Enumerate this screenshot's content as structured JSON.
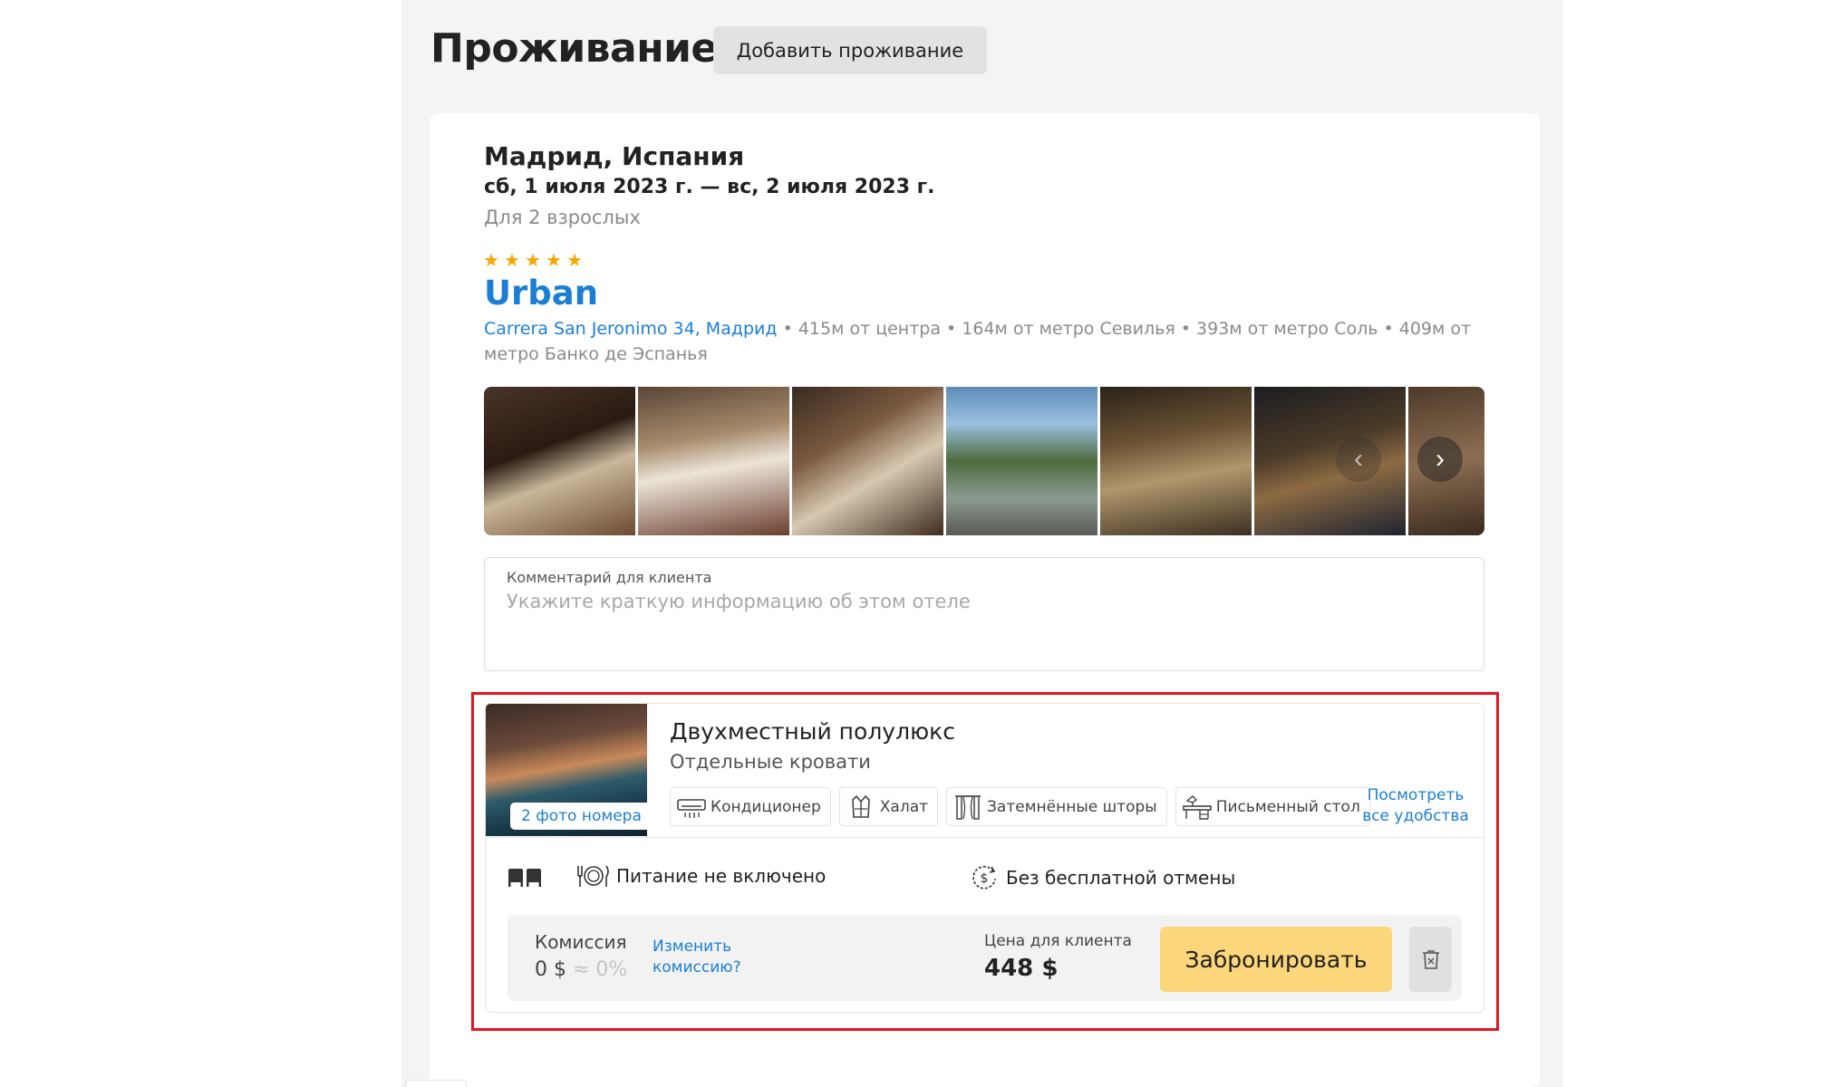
{
  "header": {
    "title": "Проживание",
    "add_button": "Добавить проживание"
  },
  "booking": {
    "city": "Мадрид, Испания",
    "dates": "сб, 1 июля 2023 г. — вс, 2 июля 2023 г.",
    "guests": "Для 2 взрослых"
  },
  "hotel": {
    "rating": 5,
    "name": "Urban",
    "address": "Carrera San Jeronimo 34, Мадрид",
    "distances": " • 415м от центра • 164м от метро Севилья • 393м от метро Соль • 409м от метро Банко де Эспанья",
    "photos": [
      "photo-1",
      "photo-2",
      "photo-3",
      "photo-4",
      "photo-5",
      "photo-6",
      "photo-7"
    ]
  },
  "comment": {
    "label": "Комментарий для клиента",
    "placeholder": "Укажите краткую информацию об этом отеле",
    "value": ""
  },
  "room": {
    "photo_badge": "2 фото номера",
    "title": "Двухместный полулюкс",
    "subtitle": "Отдельные кровати",
    "amenities": [
      {
        "icon": "air-conditioner-icon",
        "label": "Кондиционер"
      },
      {
        "icon": "bathrobe-icon",
        "label": "Халат"
      },
      {
        "icon": "blackout-curtains-icon",
        "label": "Затемнённые шторы"
      },
      {
        "icon": "desk-icon",
        "label": "Письменный стол"
      }
    ],
    "all_amenities_link": "Посмотреть все удобства",
    "meal": "Питание не включено",
    "cancellation": "Без бесплатной отмены"
  },
  "pricing": {
    "commission_label": "Комиссия",
    "commission_value": "0 $",
    "commission_pct": " ≈ 0%",
    "change_commission_link": "Изменить комиссию?",
    "client_price_label": "Цена для клиента",
    "client_price": "448 $",
    "book_button": "Забронировать"
  },
  "colors": {
    "accent_link": "#1a7fd4",
    "star": "#f6a600",
    "book_button": "#fbd67a",
    "highlight_border": "#e3141f"
  }
}
